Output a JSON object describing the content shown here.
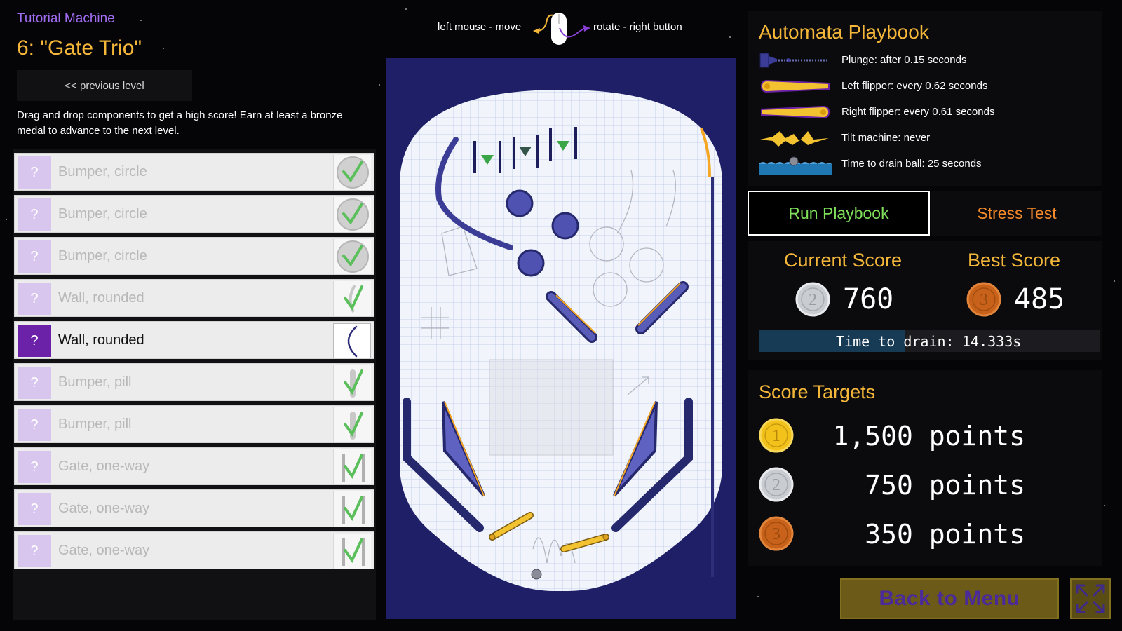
{
  "header": {
    "machine_label": "Tutorial Machine",
    "level_title": "6: \"Gate Trio\"",
    "prev_level_label": "<< previous level",
    "instructions": "Drag and drop components to get a high score! Earn at least a bronze medal to advance to the next level."
  },
  "components": [
    {
      "label": "Bumper, circle",
      "icon": "check-icon",
      "state": "placed"
    },
    {
      "label": "Bumper, circle",
      "icon": "check-icon",
      "state": "placed"
    },
    {
      "label": "Bumper, circle",
      "icon": "check-icon",
      "state": "placed"
    },
    {
      "label": "Wall, rounded",
      "icon": "check-icon",
      "state": "placed"
    },
    {
      "label": "Wall, rounded",
      "icon": "curved-wall-icon",
      "state": "selected"
    },
    {
      "label": "Bumper, pill",
      "icon": "check-icon",
      "state": "placed"
    },
    {
      "label": "Bumper, pill",
      "icon": "check-icon",
      "state": "placed"
    },
    {
      "label": "Gate, one-way",
      "icon": "check-icon",
      "state": "placed"
    },
    {
      "label": "Gate, one-way",
      "icon": "check-icon",
      "state": "placed"
    },
    {
      "label": "Gate, one-way",
      "icon": "check-icon",
      "state": "placed"
    }
  ],
  "controls_hint": {
    "left": "left mouse - move",
    "right": "rotate - right button"
  },
  "playbook": {
    "title": "Automata Playbook",
    "rows": [
      {
        "icon": "plunger-icon",
        "text": "Plunge: after 0.15 seconds"
      },
      {
        "icon": "left-flipper-icon",
        "text": "Left flipper: every 0.62 seconds"
      },
      {
        "icon": "right-flipper-icon",
        "text": "Right flipper: every 0.61 seconds"
      },
      {
        "icon": "tilt-icon",
        "text": "Tilt machine: never"
      },
      {
        "icon": "drain-icon",
        "text": "Time to drain ball: 25 seconds"
      }
    ]
  },
  "buttons": {
    "run": "Run Playbook",
    "stress": "Stress Test",
    "back": "Back to Menu"
  },
  "scores": {
    "current_label": "Current Score",
    "current_medal": "2",
    "current_value": "760",
    "best_label": "Best Score",
    "best_medal": "3",
    "best_value": "485",
    "drain_label": "Time to drain:",
    "drain_value": "14.333s",
    "drain_progress": 0.43
  },
  "targets": {
    "title": "Score Targets",
    "rows": [
      {
        "medal": "1",
        "text": "1,500 points",
        "color": "#f2c21b"
      },
      {
        "medal": "2",
        "text": "750 points",
        "color": "#c9ccd1"
      },
      {
        "medal": "3",
        "text": "350 points",
        "color": "#c8621a"
      }
    ]
  },
  "colors": {
    "accent_gold": "#f5b73a",
    "accent_purple": "#a06cf0",
    "run_green": "#7fe05a",
    "stress_orange": "#f58a2a",
    "board_navy": "#1e1f66"
  }
}
